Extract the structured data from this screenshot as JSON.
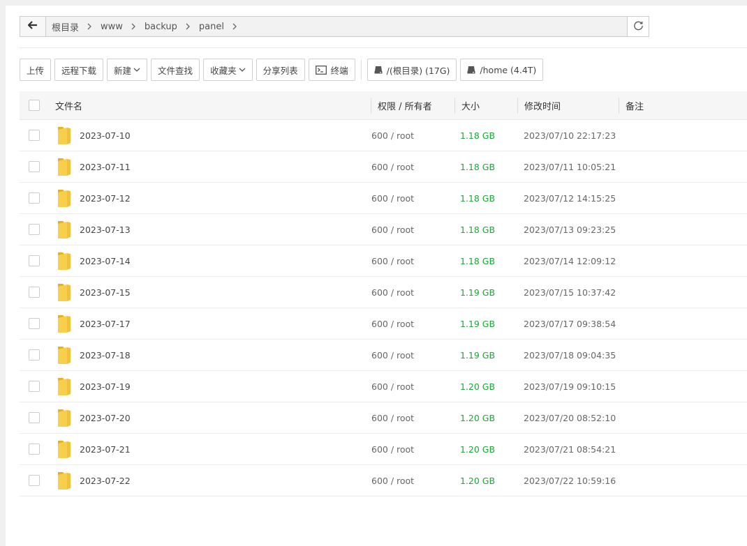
{
  "breadcrumb": {
    "items": [
      "根目录",
      "www",
      "backup",
      "panel"
    ]
  },
  "toolbar": {
    "upload": "上传",
    "remote_download": "远程下载",
    "new": "新建",
    "file_search": "文件查找",
    "favorites": "收藏夹",
    "share_list": "分享列表",
    "terminal": "终端",
    "disk_root": "/(根目录) (17G)",
    "disk_home": "/home (4.4T)"
  },
  "table": {
    "headers": {
      "name": "文件名",
      "perm": "权限 / 所有者",
      "size": "大小",
      "mtime": "修改时间",
      "note": "备注"
    },
    "rows": [
      {
        "name": "2023-07-10",
        "perm": "600 / root",
        "size": "1.18 GB",
        "mtime": "2023/07/10 22:17:23"
      },
      {
        "name": "2023-07-11",
        "perm": "600 / root",
        "size": "1.18 GB",
        "mtime": "2023/07/11 10:05:21"
      },
      {
        "name": "2023-07-12",
        "perm": "600 / root",
        "size": "1.18 GB",
        "mtime": "2023/07/12 14:15:25"
      },
      {
        "name": "2023-07-13",
        "perm": "600 / root",
        "size": "1.18 GB",
        "mtime": "2023/07/13 09:23:25"
      },
      {
        "name": "2023-07-14",
        "perm": "600 / root",
        "size": "1.18 GB",
        "mtime": "2023/07/14 12:09:12"
      },
      {
        "name": "2023-07-15",
        "perm": "600 / root",
        "size": "1.19 GB",
        "mtime": "2023/07/15 10:37:42"
      },
      {
        "name": "2023-07-17",
        "perm": "600 / root",
        "size": "1.19 GB",
        "mtime": "2023/07/17 09:38:54"
      },
      {
        "name": "2023-07-18",
        "perm": "600 / root",
        "size": "1.19 GB",
        "mtime": "2023/07/18 09:04:35"
      },
      {
        "name": "2023-07-19",
        "perm": "600 / root",
        "size": "1.20 GB",
        "mtime": "2023/07/19 09:10:15"
      },
      {
        "name": "2023-07-20",
        "perm": "600 / root",
        "size": "1.20 GB",
        "mtime": "2023/07/20 08:52:10"
      },
      {
        "name": "2023-07-21",
        "perm": "600 / root",
        "size": "1.20 GB",
        "mtime": "2023/07/21 08:54:21"
      },
      {
        "name": "2023-07-22",
        "perm": "600 / root",
        "size": "1.20 GB",
        "mtime": "2023/07/22 10:59:16"
      }
    ]
  },
  "colors": {
    "size_green": "#20a53a",
    "folder_yellow": "#f5c542"
  }
}
